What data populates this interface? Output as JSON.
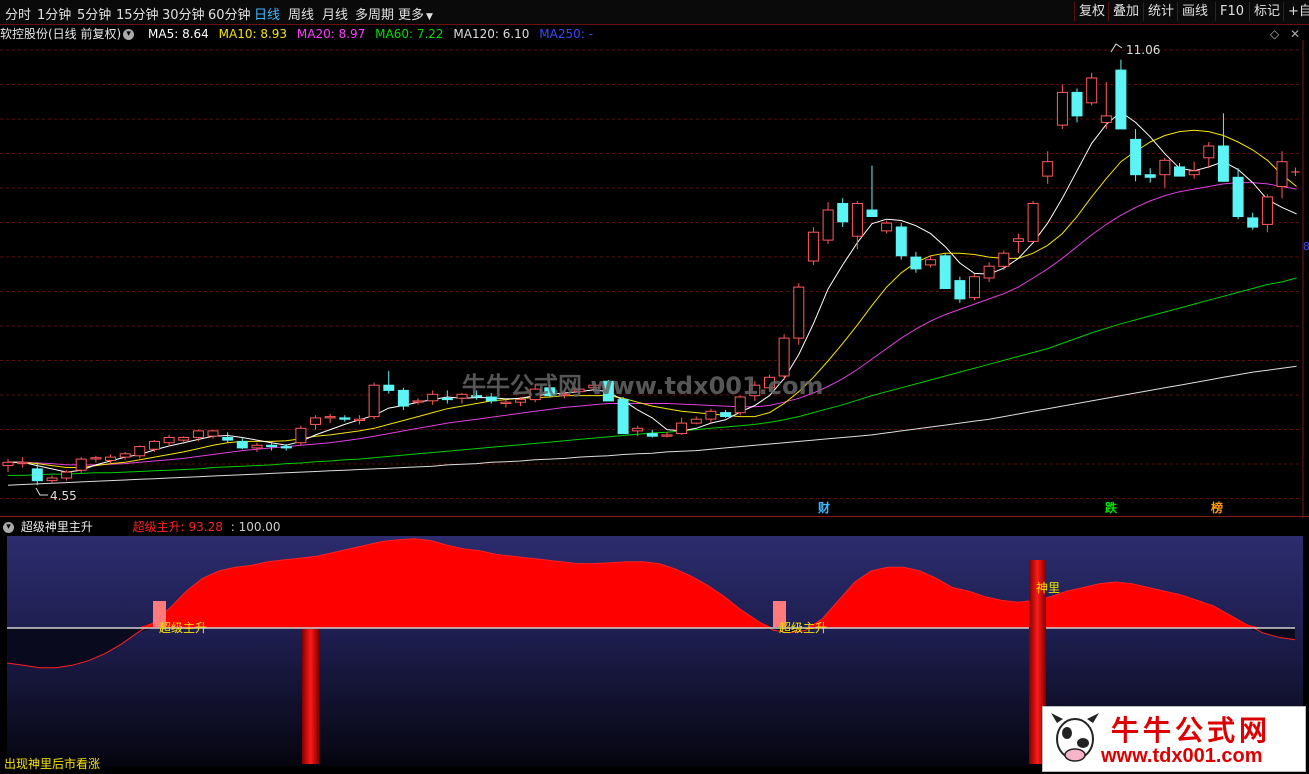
{
  "toolbar": {
    "tabs": [
      {
        "label": "分时"
      },
      {
        "label": "1分钟"
      },
      {
        "label": "5分钟"
      },
      {
        "label": "15分钟"
      },
      {
        "label": "30分钟"
      },
      {
        "label": "60分钟"
      },
      {
        "label": "日线"
      },
      {
        "label": "周线"
      },
      {
        "label": "月线"
      },
      {
        "label": "多周期"
      },
      {
        "label": "更多"
      }
    ],
    "right_buttons": [
      {
        "label": "复权"
      },
      {
        "label": "叠加"
      },
      {
        "label": "统计"
      },
      {
        "label": "画线"
      },
      {
        "label": "F10"
      },
      {
        "label": "标记"
      },
      {
        "label": "+自"
      }
    ]
  },
  "main_chart": {
    "stock_title": "软控股份(日线 前复权)",
    "ma_legend": [
      {
        "label": "MA5: 8.64",
        "color": "#ffffff"
      },
      {
        "label": "MA10: 8.93",
        "color": "#f5e400"
      },
      {
        "label": "MA20: 8.97",
        "color": "#ff40ff"
      },
      {
        "label": "MA60: 7.22",
        "color": "#00e000"
      },
      {
        "label": "MA120: 6.10",
        "color": "#dddddd"
      },
      {
        "label": "MA250: -",
        "color": "#3a4aff"
      }
    ],
    "high_label": "11.06",
    "low_label": "4.55",
    "watermark": "牛牛公式网 www.tdx001.com",
    "markers": [
      {
        "text": "财",
        "color": "#3fb8ff"
      },
      {
        "text": "跌",
        "color": "#00e000"
      },
      {
        "text": "榜",
        "color": "#ff9900"
      }
    ],
    "right_edge_label": "8"
  },
  "indicator": {
    "title": "超级神里主升",
    "value_label": "超级主升: 93.28",
    "ref_label": ": 100.00",
    "signal_labels": [
      "超级主升",
      "超级主升",
      "神里"
    ]
  },
  "footer": {
    "note": "出现神里后市看涨"
  },
  "logo": {
    "cn": "牛牛公式网",
    "url": "www.tdx001.com"
  },
  "colors": {
    "up": "#ff5a5a",
    "down": "#5cf4f4",
    "indicator_fill": "#ff0000",
    "indicator_bg_top": "#2c2c6e"
  },
  "chart_data": {
    "type": "candlestick",
    "ohlc": [
      [
        4.85,
        4.95,
        4.75,
        4.9
      ],
      [
        4.88,
        4.98,
        4.82,
        4.9
      ],
      [
        4.8,
        4.9,
        4.55,
        4.62
      ],
      [
        4.62,
        4.7,
        4.58,
        4.66
      ],
      [
        4.66,
        4.78,
        4.62,
        4.75
      ],
      [
        4.78,
        4.98,
        4.74,
        4.95
      ],
      [
        4.95,
        5.0,
        4.9,
        4.97
      ],
      [
        4.93,
        5.02,
        4.88,
        4.98
      ],
      [
        4.98,
        5.06,
        4.94,
        5.03
      ],
      [
        5.0,
        5.16,
        4.96,
        5.14
      ],
      [
        5.1,
        5.24,
        5.06,
        5.22
      ],
      [
        5.2,
        5.32,
        5.14,
        5.28
      ],
      [
        5.24,
        5.3,
        5.18,
        5.28
      ],
      [
        5.28,
        5.4,
        5.22,
        5.38
      ],
      [
        5.3,
        5.4,
        5.26,
        5.38
      ],
      [
        5.28,
        5.36,
        5.2,
        5.24
      ],
      [
        5.22,
        5.28,
        5.1,
        5.12
      ],
      [
        5.12,
        5.2,
        5.06,
        5.16
      ],
      [
        5.16,
        5.2,
        5.08,
        5.14
      ],
      [
        5.14,
        5.18,
        5.08,
        5.12
      ],
      [
        5.2,
        5.46,
        5.16,
        5.42
      ],
      [
        5.48,
        5.62,
        5.4,
        5.58
      ],
      [
        5.58,
        5.64,
        5.5,
        5.6
      ],
      [
        5.58,
        5.62,
        5.52,
        5.56
      ],
      [
        5.54,
        5.62,
        5.48,
        5.56
      ],
      [
        5.6,
        6.12,
        5.56,
        6.08
      ],
      [
        6.08,
        6.3,
        5.95,
        6.0
      ],
      [
        6.0,
        6.04,
        5.7,
        5.76
      ],
      [
        5.82,
        5.88,
        5.78,
        5.84
      ],
      [
        5.84,
        6.0,
        5.78,
        5.94
      ],
      [
        5.88,
        6.0,
        5.8,
        5.86
      ],
      [
        5.88,
        5.96,
        5.8,
        5.94
      ],
      [
        5.92,
        6.0,
        5.86,
        5.9
      ],
      [
        5.9,
        5.96,
        5.8,
        5.84
      ],
      [
        5.8,
        5.86,
        5.74,
        5.82
      ],
      [
        5.82,
        5.9,
        5.76,
        5.86
      ],
      [
        5.86,
        6.1,
        5.82,
        6.02
      ],
      [
        6.04,
        6.1,
        5.9,
        5.92
      ],
      [
        5.92,
        6.0,
        5.88,
        5.94
      ],
      [
        5.98,
        6.04,
        5.92,
        6.02
      ],
      [
        6.04,
        6.14,
        5.98,
        6.08
      ],
      [
        6.14,
        6.16,
        5.86,
        5.84
      ],
      [
        5.86,
        5.9,
        5.4,
        5.34
      ],
      [
        5.38,
        5.46,
        5.3,
        5.42
      ],
      [
        5.34,
        5.4,
        5.28,
        5.3
      ],
      [
        5.3,
        5.36,
        5.28,
        5.32
      ],
      [
        5.34,
        5.58,
        5.32,
        5.5
      ],
      [
        5.5,
        5.6,
        5.48,
        5.56
      ],
      [
        5.56,
        5.72,
        5.5,
        5.68
      ],
      [
        5.66,
        5.7,
        5.58,
        5.6
      ],
      [
        5.66,
        5.92,
        5.62,
        5.9
      ],
      [
        5.92,
        6.14,
        5.84,
        6.08
      ],
      [
        6.04,
        6.24,
        5.98,
        6.2
      ],
      [
        6.22,
        6.86,
        6.16,
        6.8
      ],
      [
        6.8,
        7.64,
        6.7,
        7.58
      ],
      [
        7.98,
        8.5,
        7.92,
        8.42
      ],
      [
        8.3,
        8.88,
        8.24,
        8.76
      ],
      [
        8.86,
        8.94,
        8.5,
        8.58
      ],
      [
        8.36,
        8.9,
        8.16,
        8.86
      ],
      [
        8.76,
        9.44,
        8.7,
        8.66
      ],
      [
        8.44,
        8.6,
        8.4,
        8.56
      ],
      [
        8.5,
        8.56,
        8.0,
        8.06
      ],
      [
        8.04,
        8.12,
        7.8,
        7.86
      ],
      [
        7.92,
        8.06,
        7.88,
        8.0
      ],
      [
        8.06,
        8.1,
        7.58,
        7.56
      ],
      [
        7.68,
        7.74,
        7.34,
        7.4
      ],
      [
        7.42,
        7.78,
        7.38,
        7.74
      ],
      [
        7.72,
        7.96,
        7.66,
        7.9
      ],
      [
        7.9,
        8.14,
        7.84,
        8.1
      ],
      [
        8.28,
        8.4,
        8.1,
        8.32
      ],
      [
        8.28,
        8.9,
        8.28,
        8.86
      ],
      [
        9.28,
        9.66,
        9.16,
        9.5
      ],
      [
        10.06,
        10.68,
        10.0,
        10.56
      ],
      [
        10.56,
        10.62,
        10.1,
        10.2
      ],
      [
        10.4,
        10.86,
        10.36,
        10.78
      ],
      [
        10.1,
        10.72,
        10.0,
        10.2
      ],
      [
        10.9,
        11.06,
        10.8,
        10.0
      ],
      [
        9.84,
        10.0,
        9.2,
        9.3
      ],
      [
        9.3,
        9.4,
        9.18,
        9.26
      ],
      [
        9.3,
        9.56,
        9.1,
        9.52
      ],
      [
        9.42,
        9.48,
        9.28,
        9.28
      ],
      [
        9.3,
        9.5,
        9.24,
        9.36
      ],
      [
        9.56,
        9.8,
        9.4,
        9.74
      ],
      [
        9.74,
        10.24,
        9.4,
        9.2
      ],
      [
        9.26,
        9.4,
        8.62,
        8.66
      ],
      [
        8.64,
        8.72,
        8.46,
        8.5
      ],
      [
        8.54,
        9.0,
        8.42,
        8.96
      ],
      [
        9.12,
        9.66,
        8.94,
        9.5
      ]
    ],
    "ma5": [
      4.9,
      4.9,
      4.85,
      4.8,
      4.75,
      4.78,
      4.86,
      4.92,
      4.98,
      5.02,
      5.09,
      5.15,
      5.2,
      5.25,
      5.3,
      5.31,
      5.28,
      5.24,
      5.2,
      5.16,
      5.22,
      5.32,
      5.4,
      5.48,
      5.55,
      5.62,
      5.73,
      5.77,
      5.82,
      5.86,
      5.9,
      5.88,
      5.89,
      5.89,
      5.87,
      5.88,
      5.92,
      5.94,
      5.96,
      5.98,
      6.01,
      5.98,
      5.85,
      5.7,
      5.58,
      5.4,
      5.38,
      5.42,
      5.5,
      5.55,
      5.67,
      5.77,
      5.92,
      6.18,
      6.55,
      7.02,
      7.55,
      7.92,
      8.26,
      8.55,
      8.62,
      8.6,
      8.52,
      8.4,
      8.2,
      7.95,
      7.79,
      7.78,
      7.87,
      8.02,
      8.26,
      8.56,
      8.94,
      9.36,
      9.78,
      10.07,
      10.26,
      10.1,
      9.88,
      9.62,
      9.4,
      9.36,
      9.42,
      9.5,
      9.38,
      9.18,
      8.92,
      8.8,
      8.7
    ],
    "ma10": [
      4.9,
      4.9,
      4.88,
      4.85,
      4.82,
      4.82,
      4.85,
      4.88,
      4.9,
      4.94,
      4.98,
      5.02,
      5.06,
      5.11,
      5.16,
      5.2,
      5.22,
      5.22,
      5.22,
      5.23,
      5.26,
      5.3,
      5.32,
      5.35,
      5.38,
      5.42,
      5.48,
      5.54,
      5.6,
      5.66,
      5.72,
      5.76,
      5.8,
      5.84,
      5.86,
      5.88,
      5.89,
      5.9,
      5.92,
      5.92,
      5.92,
      5.92,
      5.88,
      5.82,
      5.76,
      5.72,
      5.68,
      5.66,
      5.64,
      5.62,
      5.6,
      5.6,
      5.66,
      5.8,
      5.98,
      6.2,
      6.45,
      6.72,
      7.0,
      7.3,
      7.58,
      7.8,
      7.96,
      8.06,
      8.1,
      8.1,
      8.08,
      8.04,
      8.02,
      8.02,
      8.1,
      8.22,
      8.4,
      8.66,
      8.96,
      9.24,
      9.5,
      9.66,
      9.8,
      9.9,
      9.96,
      9.98,
      9.96,
      9.9,
      9.8,
      9.68,
      9.52,
      9.3,
      9.12
    ],
    "ma20": [
      4.9,
      4.9,
      4.89,
      4.88,
      4.86,
      4.86,
      4.86,
      4.87,
      4.88,
      4.9,
      4.92,
      4.94,
      4.96,
      4.99,
      5.02,
      5.05,
      5.08,
      5.1,
      5.12,
      5.14,
      5.16,
      5.18,
      5.2,
      5.23,
      5.26,
      5.3,
      5.34,
      5.38,
      5.42,
      5.46,
      5.5,
      5.53,
      5.56,
      5.59,
      5.62,
      5.65,
      5.68,
      5.71,
      5.74,
      5.76,
      5.78,
      5.8,
      5.8,
      5.8,
      5.8,
      5.8,
      5.79,
      5.78,
      5.77,
      5.76,
      5.75,
      5.75,
      5.77,
      5.82,
      5.88,
      5.96,
      6.06,
      6.18,
      6.32,
      6.48,
      6.64,
      6.8,
      6.94,
      7.06,
      7.16,
      7.24,
      7.32,
      7.4,
      7.48,
      7.58,
      7.72,
      7.86,
      8.02,
      8.2,
      8.38,
      8.54,
      8.68,
      8.8,
      8.9,
      8.98,
      9.04,
      9.08,
      9.12,
      9.16,
      9.18,
      9.18,
      9.16,
      9.12,
      9.08
    ],
    "ma60": [
      4.7,
      4.7,
      4.71,
      4.72,
      4.72,
      4.73,
      4.74,
      4.74,
      4.75,
      4.76,
      4.77,
      4.78,
      4.79,
      4.8,
      4.82,
      4.83,
      4.84,
      4.85,
      4.86,
      4.88,
      4.89,
      4.91,
      4.92,
      4.94,
      4.95,
      4.97,
      4.99,
      5.01,
      5.03,
      5.05,
      5.07,
      5.09,
      5.11,
      5.13,
      5.15,
      5.17,
      5.19,
      5.21,
      5.23,
      5.25,
      5.27,
      5.29,
      5.31,
      5.33,
      5.35,
      5.36,
      5.38,
      5.4,
      5.42,
      5.44,
      5.46,
      5.48,
      5.51,
      5.55,
      5.6,
      5.66,
      5.72,
      5.78,
      5.85,
      5.92,
      5.98,
      6.04,
      6.1,
      6.16,
      6.22,
      6.28,
      6.34,
      6.4,
      6.46,
      6.52,
      6.58,
      6.64,
      6.72,
      6.8,
      6.88,
      6.95,
      7.02,
      7.08,
      7.14,
      7.2,
      7.26,
      7.32,
      7.38,
      7.44,
      7.5,
      7.56,
      7.62,
      7.66,
      7.72
    ],
    "ma120": [
      4.55,
      4.56,
      4.57,
      4.58,
      4.59,
      4.6,
      4.61,
      4.62,
      4.63,
      4.64,
      4.65,
      4.66,
      4.67,
      4.68,
      4.69,
      4.7,
      4.71,
      4.72,
      4.73,
      4.74,
      4.75,
      4.76,
      4.77,
      4.78,
      4.79,
      4.8,
      4.81,
      4.82,
      4.83,
      4.84,
      4.86,
      4.87,
      4.88,
      4.9,
      4.91,
      4.92,
      4.94,
      4.95,
      4.96,
      4.98,
      4.99,
      5.0,
      5.02,
      5.03,
      5.04,
      5.06,
      5.07,
      5.08,
      5.1,
      5.12,
      5.14,
      5.16,
      5.18,
      5.2,
      5.22,
      5.24,
      5.26,
      5.28,
      5.3,
      5.32,
      5.35,
      5.38,
      5.41,
      5.44,
      5.47,
      5.5,
      5.53,
      5.56,
      5.6,
      5.64,
      5.68,
      5.72,
      5.76,
      5.8,
      5.84,
      5.88,
      5.92,
      5.96,
      6.0,
      6.04,
      6.08,
      6.12,
      6.16,
      6.2,
      6.24,
      6.28,
      6.31,
      6.34,
      6.37
    ],
    "indicator_series": [
      -30,
      -32,
      -34,
      -34,
      -32,
      -28,
      -22,
      -14,
      -4,
      6,
      22,
      40,
      54,
      62,
      66,
      68,
      72,
      74,
      76,
      78,
      82,
      86,
      90,
      94,
      96,
      97,
      95,
      90,
      86,
      84,
      80,
      78,
      76,
      74,
      72,
      70,
      70,
      71,
      72,
      72,
      70,
      64,
      56,
      46,
      34,
      20,
      8,
      -2,
      -4,
      -2,
      10,
      30,
      50,
      62,
      66,
      66,
      62,
      54,
      44,
      40,
      34,
      30,
      28,
      30,
      34,
      40,
      44,
      48,
      50,
      48,
      44,
      40,
      36,
      30,
      24,
      14,
      4,
      -4,
      -8,
      -10
    ],
    "indicator_range": [
      -60,
      100
    ]
  }
}
